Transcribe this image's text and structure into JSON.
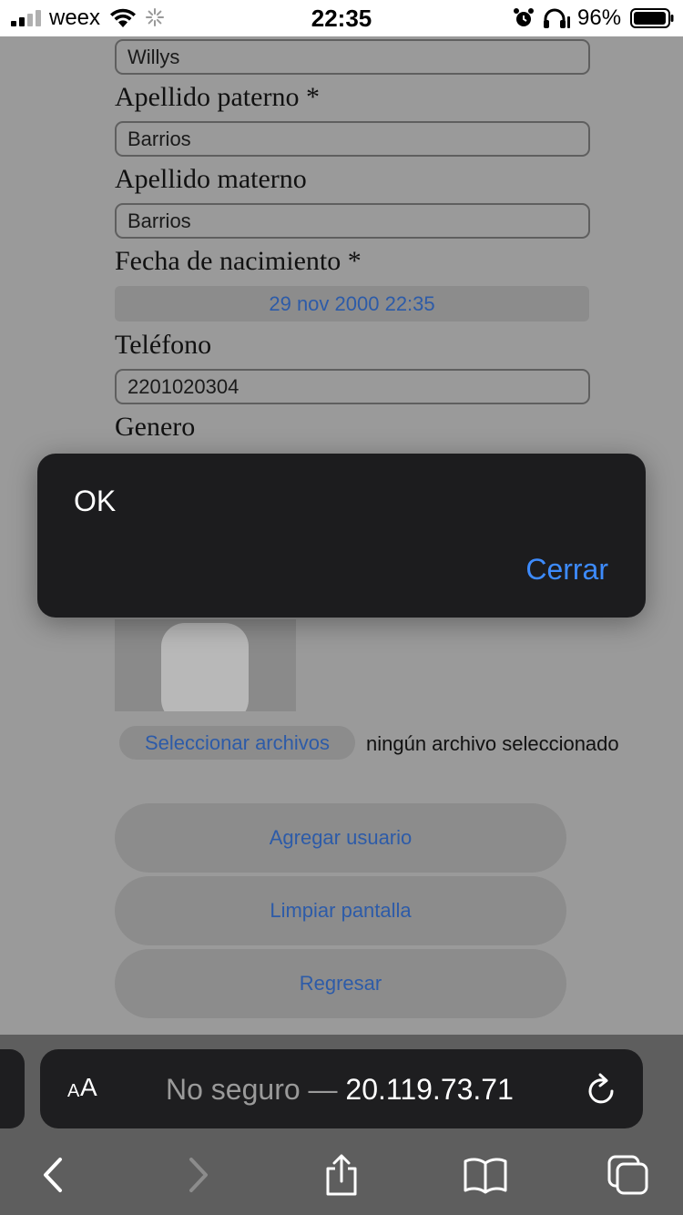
{
  "status_bar": {
    "carrier": "weex",
    "time": "22:35",
    "battery": "96%"
  },
  "form": {
    "name_value": "Willys",
    "paternal_label": "Apellido paterno *",
    "paternal_value": "Barrios",
    "maternal_label": "Apellido materno",
    "maternal_value": "Barrios",
    "birth_label": "Fecha de nacimiento *",
    "birth_value": "29 nov 2000 22:35",
    "phone_label": "Teléfono",
    "phone_value": "2201020304",
    "gender_label": "Genero",
    "file_button": "Seleccionar archivos",
    "file_status": "ningún archivo seleccionado",
    "add_user": "Agregar usuario",
    "clear_screen": "Limpiar pantalla",
    "back": "Regresar"
  },
  "alert": {
    "message": "OK",
    "close_label": "Cerrar"
  },
  "browser": {
    "text_size_small": "A",
    "text_size_large": "A",
    "url_prefix": "No seguro — ",
    "url_host": "20.119.73.71"
  },
  "colors": {
    "link_blue": "#2d5ba8",
    "alert_accent": "#3d8bfd",
    "alert_bg": "#1c1c1e"
  }
}
